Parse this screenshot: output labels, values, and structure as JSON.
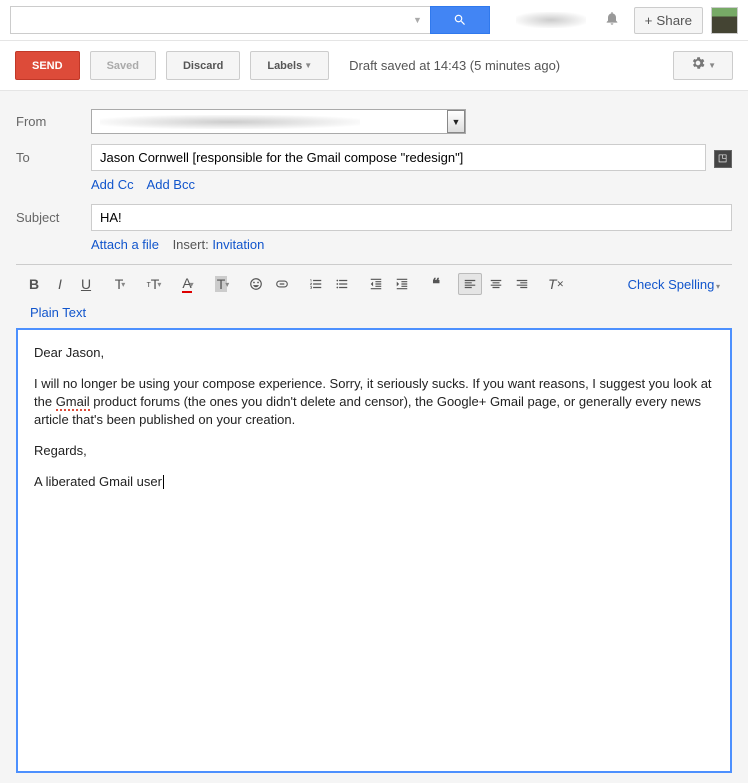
{
  "top": {
    "search_placeholder": "",
    "share_label": "Share"
  },
  "actions": {
    "send": "Send",
    "saved": "Saved",
    "discard": "Discard",
    "labels": "Labels",
    "draft_status": "Draft saved at 14:43 (5 minutes ago)"
  },
  "fields": {
    "from_label": "From",
    "to_label": "To",
    "to_value": "Jason Cornwell [responsible for the Gmail compose \"redesign\"]",
    "add_cc": "Add Cc",
    "add_bcc": "Add Bcc",
    "subject_label": "Subject",
    "subject_value": "HA!",
    "attach": "Attach a file",
    "insert_label": "Insert:",
    "invitation": "Invitation"
  },
  "toolbar": {
    "check_spelling": "Check Spelling",
    "plain_text": "Plain Text"
  },
  "body": {
    "p1": "Dear Jason,",
    "p2a": "I will no longer be using your compose experience. Sorry, it seriously sucks. If you want reasons, I suggest you look at the ",
    "p2err": "Gmail",
    "p2b": " product forums (the ones you didn't delete and censor), the Google+ Gmail page, or generally every news article that's been published on your creation.",
    "p3": "Regards,",
    "p4": "A liberated Gmail user"
  }
}
